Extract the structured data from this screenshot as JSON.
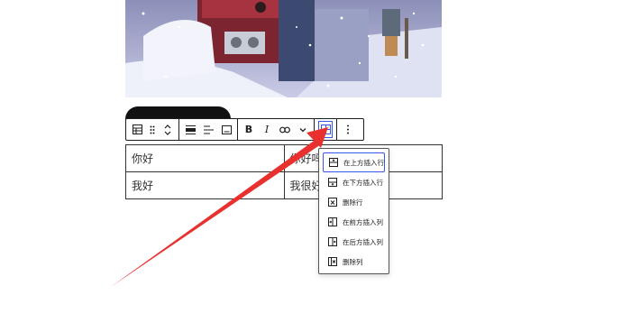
{
  "table": {
    "rows": [
      [
        "你好",
        "你好吗"
      ],
      [
        "我好",
        "我很好"
      ]
    ]
  },
  "toolbar": {
    "icons": [
      "table-icon",
      "drag-handle-icon",
      "move-up-down-icon",
      "align-full-icon",
      "align-left-icon",
      "caption-icon",
      "bold-icon",
      "italic-icon",
      "link-icon",
      "chevron-down-icon",
      "edit-table-icon",
      "more-options-icon"
    ],
    "bold_label": "B",
    "italic_label": "I"
  },
  "menu": {
    "items": [
      {
        "label": "在上方插入行",
        "icon": "insert-row-before-icon",
        "selected": true
      },
      {
        "label": "在下方插入行",
        "icon": "insert-row-after-icon",
        "selected": false
      },
      {
        "label": "删除行",
        "icon": "delete-row-icon",
        "selected": false
      },
      {
        "label": "在前方插入列",
        "icon": "insert-column-before-icon",
        "selected": false
      },
      {
        "label": "在后方插入列",
        "icon": "insert-column-after-icon",
        "selected": false
      },
      {
        "label": "删除列",
        "icon": "delete-column-icon",
        "selected": false
      }
    ]
  },
  "colors": {
    "accent": "#3858e9",
    "annotation_arrow": "#e8302e",
    "toolbar_border": "#1e1e1e"
  }
}
